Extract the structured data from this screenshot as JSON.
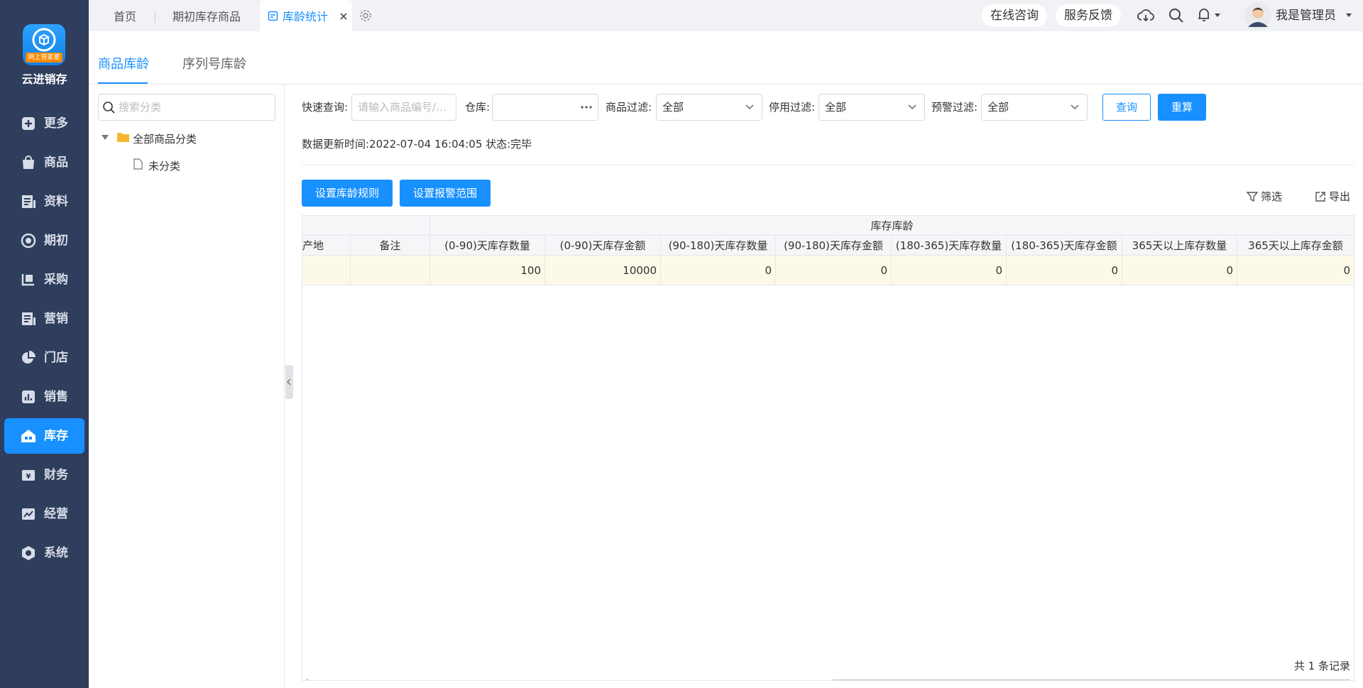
{
  "app": {
    "name": "云进销存",
    "logo_badge": "网上管家婆"
  },
  "sidebar": {
    "items": [
      {
        "label": "更多",
        "icon": "plus-square-icon"
      },
      {
        "label": "商品",
        "icon": "bag-icon"
      },
      {
        "label": "资料",
        "icon": "document-icon"
      },
      {
        "label": "期初",
        "icon": "target-icon"
      },
      {
        "label": "采购",
        "icon": "cart-icon"
      },
      {
        "label": "营销",
        "icon": "document-list-icon"
      },
      {
        "label": "门店",
        "icon": "pie-chart-icon"
      },
      {
        "label": "销售",
        "icon": "bar-chart-icon"
      },
      {
        "label": "库存",
        "icon": "warehouse-icon",
        "active": true
      },
      {
        "label": "财务",
        "icon": "yen-icon"
      },
      {
        "label": "经营",
        "icon": "trend-icon"
      },
      {
        "label": "系统",
        "icon": "hexagon-gear-icon"
      }
    ]
  },
  "tabs": {
    "home": "首页",
    "initial_goods": "期初库存商品",
    "age_stats": "库龄统计"
  },
  "topbar": {
    "online_consult": "在线咨询",
    "feedback": "服务反馈",
    "user_name": "我是管理员"
  },
  "subtabs": {
    "goods_age": "商品库龄",
    "serial_age": "序列号库龄"
  },
  "category": {
    "search_placeholder": "搜索分类",
    "root": "全部商品分类",
    "child": "未分类"
  },
  "filters": {
    "quick_label": "快速查询:",
    "quick_placeholder": "请输入商品编号/商...",
    "warehouse_label": "仓库:",
    "warehouse_value": "",
    "goods_filter_label": "商品过滤:",
    "goods_filter_value": "全部",
    "disable_filter_label": "停用过滤:",
    "disable_filter_value": "全部",
    "warning_filter_label": "预警过滤:",
    "warning_filter_value": "全部",
    "query_button": "查询",
    "recalc_button": "重算"
  },
  "status": {
    "update_text": "数据更新时间:2022-07-04 16:04:05  状态:完毕"
  },
  "actions": {
    "set_rule": "设置库龄规则",
    "set_alarm": "设置报警范围",
    "filter": "筛选",
    "export": "导出"
  },
  "table": {
    "group_header": "库存库龄",
    "headers": [
      "产地",
      "备注",
      "(0-90)天库存数量",
      "(0-90)天库存金额",
      "(90-180)天库存数量",
      "(90-180)天库存金额",
      "(180-365)天库存数量",
      "(180-365)天库存金额",
      "365天以上库存数量",
      "365天以上库存金额"
    ],
    "rows": [
      [
        "",
        "",
        "100",
        "10000",
        "0",
        "0",
        "0",
        "0",
        "0",
        "0"
      ]
    ]
  },
  "footer": {
    "record_count": "共 1 条记录"
  }
}
